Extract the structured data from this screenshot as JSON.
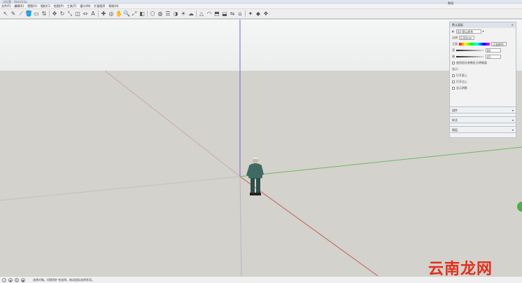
{
  "titlebar": {
    "title": "无标题 - SketchUp"
  },
  "menubar": {
    "items": [
      "文件(F)",
      "编辑(E)",
      "视图(V)",
      "相机(C)",
      "绘图(R)",
      "工具(T)",
      "窗口(W)",
      "扩展程序",
      "帮助(H)"
    ]
  },
  "toolbar": {
    "icons": [
      "select-icon",
      "eraser-icon",
      "pencil-icon",
      "paint-bucket-icon",
      "shapes-icon",
      "push-pull-icon",
      "move-icon",
      "rotate-icon",
      "scale-icon",
      "offset-icon",
      "tape-icon",
      "text-icon",
      "axes-icon",
      "orbit-icon",
      "pan-icon",
      "zoom-icon",
      "zoom-extents-icon",
      "section-icon",
      "components-icon",
      "materials-icon",
      "layers-icon",
      "styles-icon",
      "shadows-icon",
      "fog-icon",
      "sandbox-icon",
      "smoove-icon",
      "stamp-icon",
      "drape-icon",
      "flip-icon",
      "warehouse-icon",
      "extension-icon",
      "ruby-icon",
      "render-icon"
    ],
    "glyphs": [
      "↖",
      "✎",
      "⟋",
      "🪣",
      "▭",
      "⇅",
      "✥",
      "↻",
      "⤡",
      "◫",
      "⇔",
      "A",
      "✚",
      "◎",
      "✋",
      "🔍",
      "⤢",
      "◧",
      "⬡",
      "◍",
      "☰",
      "◑",
      "☀",
      "☁",
      "△",
      "◠",
      "⬒",
      "⬓",
      "⇋",
      "⌂",
      "✦",
      "◆",
      "❖"
    ]
  },
  "tray": {
    "title": "默认面板",
    "style_select": "[0] 默认颜色",
    "label_edge": "边线",
    "edge_value": "0.00mm",
    "label_face": "正面",
    "face_value": "正面颜色",
    "label_light": "亮",
    "light_value": "80",
    "label_dark": "暗",
    "dark_value": "45",
    "checkbox_label": "使用阳光参数区分明暗面",
    "display_label": "显示：",
    "option1": "打开面上",
    "option2": "打开边上",
    "option3": "显示阴影"
  },
  "panels": [
    "组件",
    "样式",
    "图层"
  ],
  "statusbar": {
    "message": "选择对象。切换到扩充选择。拖动鼠标选择多项。"
  },
  "measurements": {
    "label": "数值",
    "value": ""
  },
  "watermark": {
    "text": "云南龙网"
  },
  "colors": {
    "red_axis": "#c0605a",
    "green_axis": "#6bb86b",
    "blue_axis": "#6a6acc",
    "watermark": "#e0301e"
  }
}
